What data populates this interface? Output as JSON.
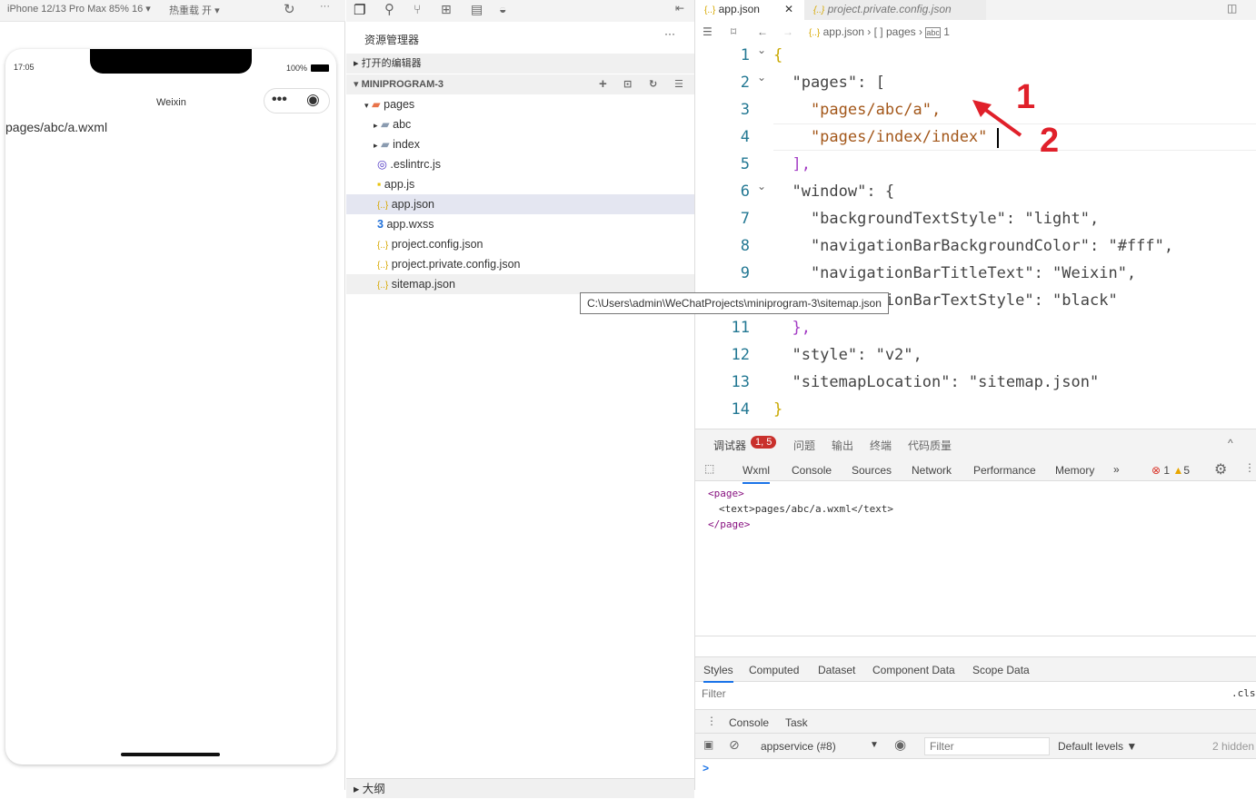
{
  "simulator": {
    "device": "iPhone 12/13 Pro Max 85% 16 ▾",
    "hotreload": "热重载 开 ▾",
    "time": "17:05",
    "battery": "100%",
    "nav_title": "Weixin",
    "page_text": "pages/abc/a.wxml"
  },
  "explorer": {
    "title": "资源管理器",
    "open_editors": "打开的编辑器",
    "project": "MINIPROGRAM-3",
    "outline": "大纲",
    "items": [
      {
        "label": "pages",
        "icon": "folder-open-icon"
      },
      {
        "label": "abc",
        "icon": "folder-icon"
      },
      {
        "label": "index",
        "icon": "folder-icon"
      },
      {
        "label": ".eslintrc.js",
        "icon": "eslint-icon"
      },
      {
        "label": "app.js",
        "icon": "js-icon"
      },
      {
        "label": "app.json",
        "icon": "json-icon"
      },
      {
        "label": "app.wxss",
        "icon": "css-icon"
      },
      {
        "label": "project.config.json",
        "icon": "json-icon"
      },
      {
        "label": "project.private.config.json",
        "icon": "json-icon"
      },
      {
        "label": "sitemap.json",
        "icon": "json-icon"
      }
    ],
    "tooltip": "C:\\Users\\admin\\WeChatProjects\\miniprogram-3\\sitemap.json"
  },
  "editor": {
    "tabs": [
      "app.json",
      "project.private.config.json"
    ],
    "breadcrumb": [
      "app.json",
      "[ ] pages",
      "1"
    ],
    "annotations": [
      "1",
      "2"
    ],
    "lines": [
      "{",
      "  \"pages\": [",
      "    \"pages/abc/a\",",
      "    \"pages/index/index\"",
      "  ],",
      "  \"window\": {",
      "    \"backgroundTextStyle\": \"light\",",
      "    \"navigationBarBackgroundColor\": \"#fff\",",
      "    \"navigationBarTitleText\": \"Weixin\",",
      "    \"navigationBarTextStyle\": \"black\"",
      "  },",
      "  \"style\": \"v2\",",
      "  \"sitemapLocation\": \"sitemap.json\"",
      "}"
    ]
  },
  "devtools": {
    "top_tabs": [
      "调试器",
      "问题",
      "输出",
      "终端",
      "代码质量"
    ],
    "badge": "1, 5",
    "panels": [
      "Wxml",
      "Console",
      "Sources",
      "Network",
      "Performance",
      "Memory"
    ],
    "errors": "1",
    "warnings": "5",
    "wxml": [
      "<page>",
      "<text>pages/abc/a.wxml</text>",
      "</page>"
    ],
    "style_tabs": [
      "Styles",
      "Computed",
      "Dataset",
      "Component Data",
      "Scope Data"
    ],
    "filter_placeholder": "Filter",
    "cls": ".cls",
    "drawer_tabs": [
      "Console",
      "Task"
    ],
    "context": "appservice (#8)",
    "levels": "Default levels ▼",
    "hidden": "2 hidden",
    "prompt": ">"
  }
}
